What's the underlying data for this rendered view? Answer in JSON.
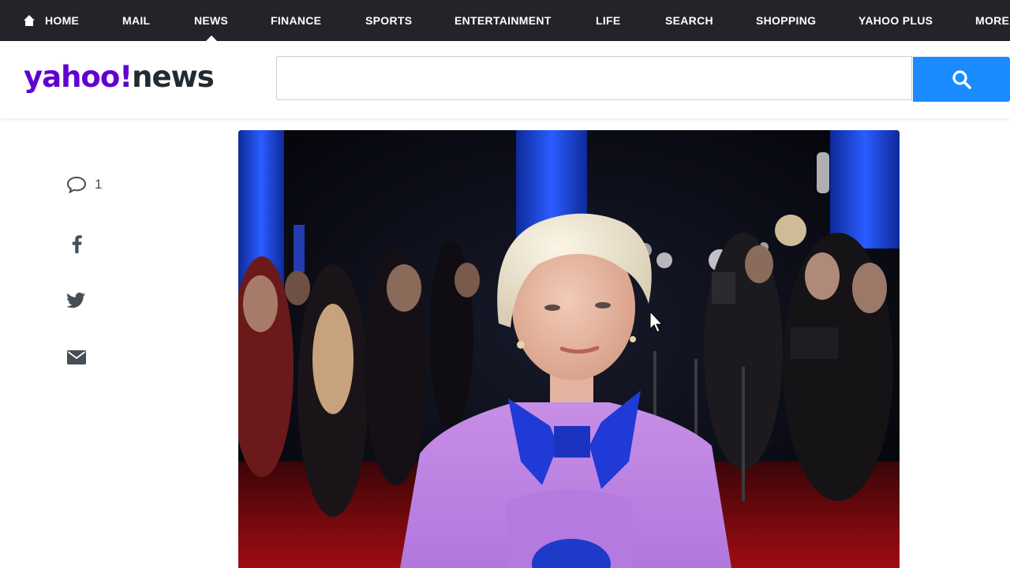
{
  "topnav": {
    "items": [
      {
        "label": "HOME"
      },
      {
        "label": "MAIL"
      },
      {
        "label": "NEWS"
      },
      {
        "label": "FINANCE"
      },
      {
        "label": "SPORTS"
      },
      {
        "label": "ENTERTAINMENT"
      },
      {
        "label": "LIFE"
      },
      {
        "label": "SEARCH"
      },
      {
        "label": "SHOPPING"
      },
      {
        "label": "YAHOO PLUS"
      },
      {
        "label": "MORE"
      }
    ],
    "active": "NEWS"
  },
  "header": {
    "logo_yahoo": "yahoo!",
    "logo_news": "news",
    "search_value": ""
  },
  "share_rail": {
    "comment_count": "1",
    "icons": [
      "comment-icon",
      "facebook-icon",
      "twitter-icon",
      "mail-icon"
    ]
  },
  "article": {
    "photo_icon": "article-hero-photo"
  },
  "colors": {
    "nav_bg": "#232429",
    "brand_purple": "#6001d2",
    "search_blue": "#1a8cff"
  }
}
